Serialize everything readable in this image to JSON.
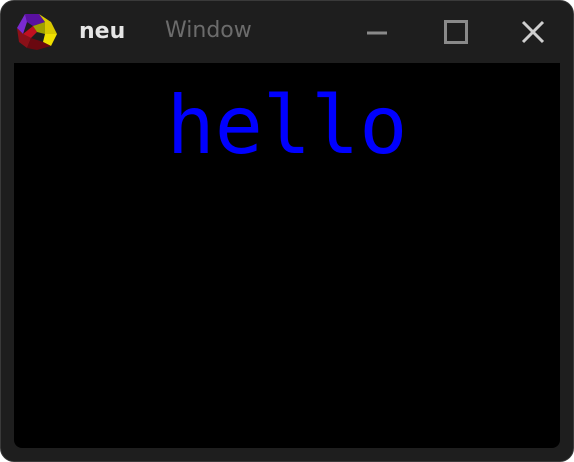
{
  "window": {
    "app_name": "neu",
    "title": "Window",
    "controls": {
      "minimize_icon": "minimize-icon",
      "maximize_icon": "maximize-icon",
      "close_icon": "close-icon"
    }
  },
  "app_icon": "app-logo-icon",
  "content": {
    "text": "hello",
    "text_color": "#0000ff",
    "background": "#000000"
  },
  "colors": {
    "titlebar": "#1e1e1e",
    "icon_red": "#8a1018",
    "icon_yellow": "#f0e000",
    "icon_purple": "#5a10a0"
  }
}
